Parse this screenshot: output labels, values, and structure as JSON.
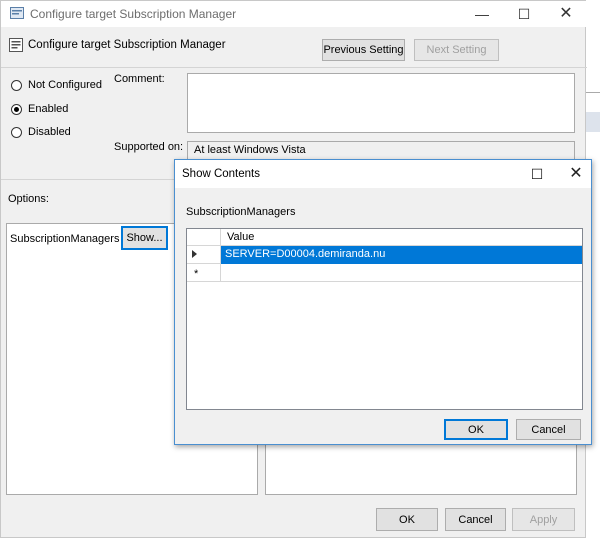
{
  "window": {
    "title": "Configure target Subscription Manager",
    "minimize_glyph": "—",
    "maximize_glyph": "☐",
    "close_glyph": "✕"
  },
  "header": {
    "title": "Configure target Subscription Manager",
    "previous_label": "Previous Setting",
    "next_label": "Next Setting"
  },
  "state": {
    "not_configured": "Not Configured",
    "enabled": "Enabled",
    "disabled": "Disabled",
    "selected": "enabled"
  },
  "comment": {
    "label": "Comment:",
    "value": ""
  },
  "supported": {
    "label": "Supported on:",
    "value": "At least Windows Vista"
  },
  "options": {
    "label": "Options:",
    "subscription_label": "SubscriptionManagers",
    "show_label": "Show..."
  },
  "footer": {
    "ok_label": "OK",
    "cancel_label": "Cancel",
    "apply_label": "Apply"
  },
  "show_contents": {
    "title": "Show Contents",
    "maximize_glyph": "☐",
    "close_glyph": "✕",
    "list_label": "SubscriptionManagers",
    "column_header": "Value",
    "rows": [
      "SERVER=D00004.demiranda.nu"
    ],
    "new_row_marker": "*",
    "ok_label": "OK",
    "cancel_label": "Cancel"
  },
  "icons": {
    "window_icon": "policy-window-icon",
    "header_icon": "policy-setting-icon",
    "row_indicator": "current-row-arrow-icon"
  },
  "colors": {
    "selection": "#0078d7",
    "dialog_bg": "#f0f0f0",
    "border_accent": "#4a8fd0"
  }
}
